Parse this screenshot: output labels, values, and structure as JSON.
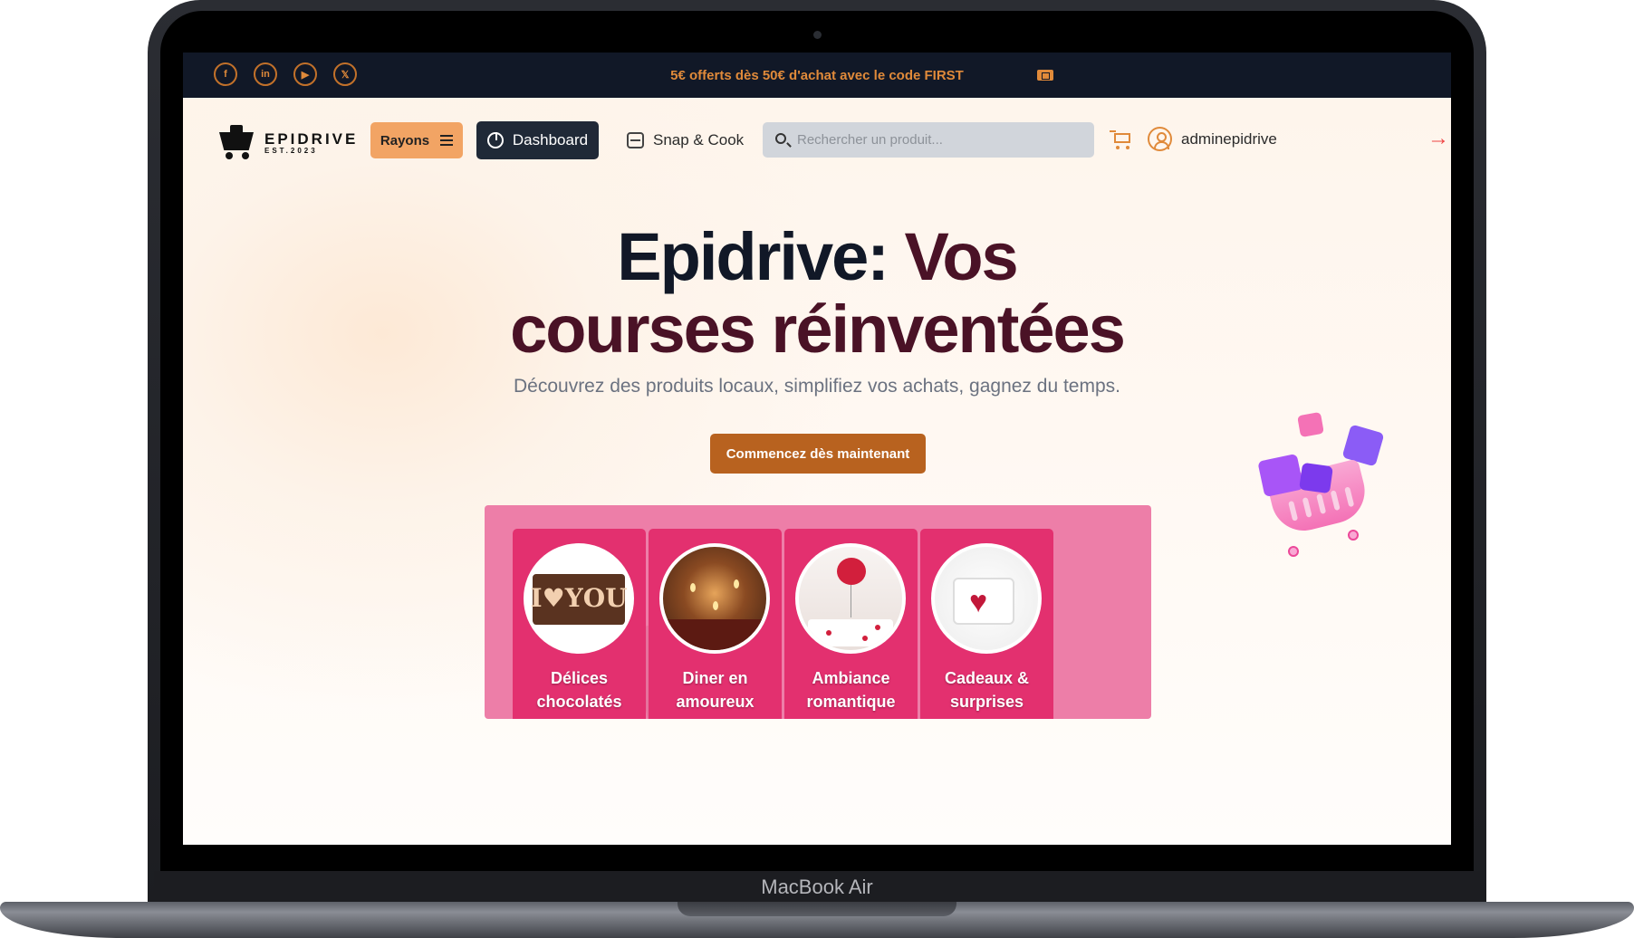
{
  "device": {
    "label": "MacBook Air"
  },
  "promo": {
    "text": "5€ offerts dès 50€ d'achat avec le code FIRST",
    "icon": "ticket-icon",
    "socials": [
      {
        "name": "facebook-icon",
        "glyph": "f"
      },
      {
        "name": "linkedin-icon",
        "glyph": "in"
      },
      {
        "name": "youtube-icon",
        "glyph": "▶"
      },
      {
        "name": "x-icon",
        "glyph": "𝕏"
      }
    ]
  },
  "nav": {
    "logo": {
      "main": "EPIDRIVE",
      "sub": "EST.2023"
    },
    "rayons_label": "Rayons",
    "dashboard_label": "Dashboard",
    "snap_label": "Snap & Cook",
    "search_placeholder": "Rechercher un produit...",
    "username": "adminepidrive",
    "logout_glyph": "→"
  },
  "hero": {
    "title_part1": "Epidrive: ",
    "title_part2": "Vos",
    "title_line2": "courses réinventées",
    "subtitle": "Découvrez des produits locaux, simplifiez vos achats, gagnez du temps.",
    "cta_label": "Commencez dès maintenant"
  },
  "categories": [
    {
      "line1": "Délices",
      "line2": "chocolatés",
      "image_text": "I♥YOU"
    },
    {
      "line1": "Diner en",
      "line2": "amoureux"
    },
    {
      "line1": "Ambiance",
      "line2": "romantique"
    },
    {
      "line1": "Cadeaux &",
      "line2": "surprises"
    }
  ],
  "colors": {
    "accent": "#e08a3a",
    "dark": "#111827",
    "wine": "#4a1226",
    "panel_pink": "#ed7ea8",
    "card_pink": "#e3306f",
    "cta": "#b8621f"
  }
}
